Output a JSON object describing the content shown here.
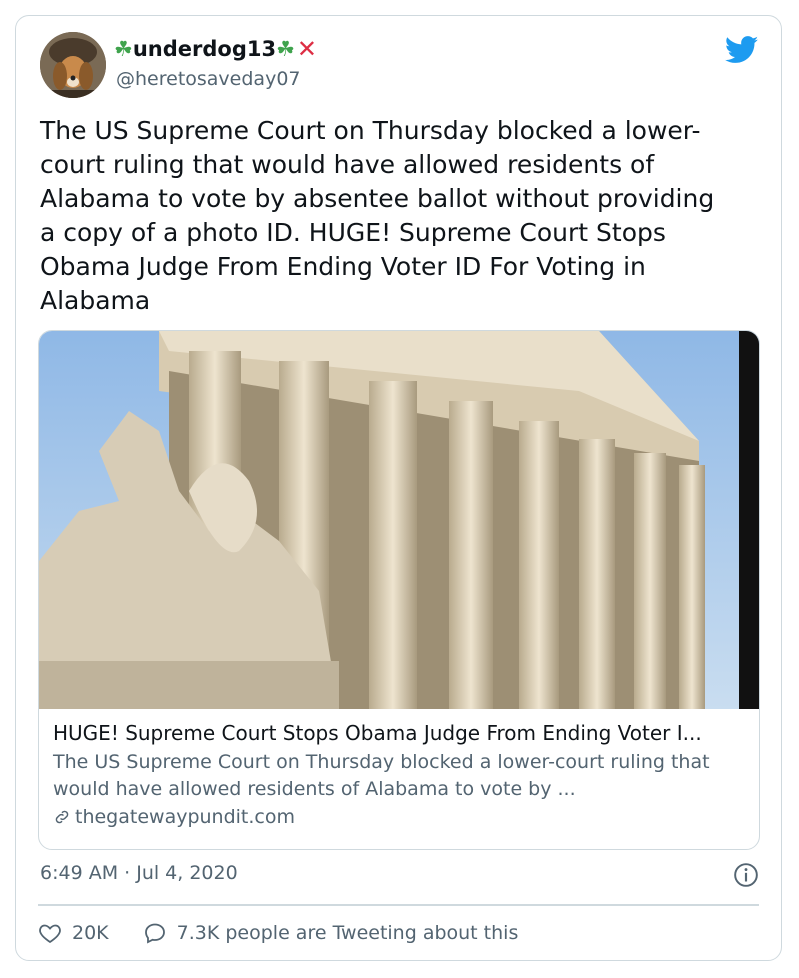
{
  "user": {
    "display_name": "underdog13",
    "handle": "@heretosaveday07",
    "clover": "☘",
    "x_mark": "✕"
  },
  "tweet": {
    "text": "The US Supreme Court on Thursday blocked a lower-\ncourt ruling that would have allowed residents of\nAlabama to vote by absentee ballot without providing\na copy of a photo ID. HUGE! Supreme Court Stops\nObama Judge From Ending Voter ID For Voting in\nAlabama"
  },
  "link_card": {
    "title": "HUGE! Supreme Court Stops Obama Judge From Ending Voter I...",
    "description": "The US Supreme Court on Thursday blocked a lower-court ruling that would have allowed residents of Alabama to vote by ...",
    "domain": "thegatewaypundit.com"
  },
  "timestamp": "6:49 AM · Jul 4, 2020",
  "stats": {
    "likes": "20K",
    "tweeting": "7.3K people are Tweeting about this"
  },
  "colors": {
    "brand": "#1d9bf0",
    "muted": "#536471",
    "border": "#cfd9de"
  },
  "icons": [
    "twitter-bird-icon",
    "info-icon",
    "heart-icon",
    "reply-icon",
    "link-icon"
  ]
}
